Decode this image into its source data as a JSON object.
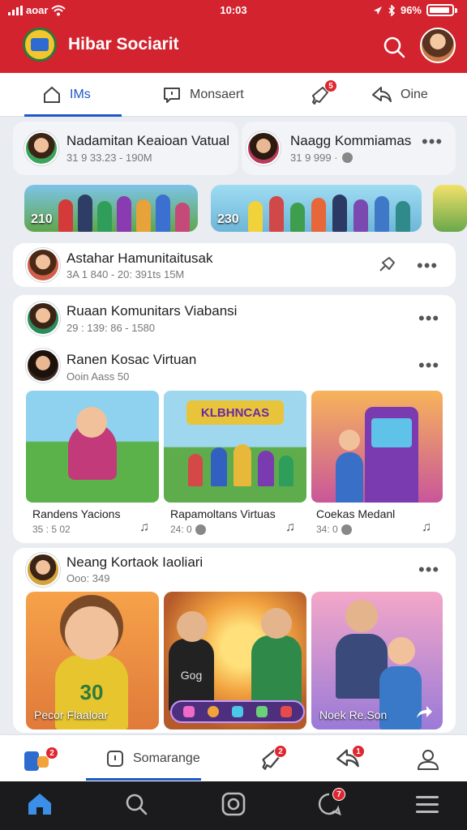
{
  "status": {
    "carrier": "aoar",
    "time": "10:03",
    "battery": "96%"
  },
  "app": {
    "title": "Hibar Sociarit"
  },
  "tabs": [
    {
      "label": "IMs"
    },
    {
      "label": "Monsaert"
    },
    {
      "label": "",
      "badge": "5"
    },
    {
      "label": "Oine"
    }
  ],
  "stories": [
    {
      "name": "Nadamitan Keaioan Vatual",
      "meta": "31 9 33.23 - 190M"
    },
    {
      "name": "Naagg Kommiamas",
      "meta": "31 9 999 ·"
    }
  ],
  "banners": [
    {
      "count": "210"
    },
    {
      "count": "230"
    }
  ],
  "post1": {
    "name": "Astahar Hamunitaitusak",
    "meta": "3A 1 840 - 20: 391ts 15M"
  },
  "group": {
    "name": "Ruaan Komunitars Viabansi",
    "meta": "29 : 139: 86 - 1580",
    "sub": {
      "name": "Ranen Kosac Virtuan",
      "meta": "Ooin Aass 50"
    },
    "tiles": [
      {
        "title": "Randens Yacions",
        "meta": "35 : 5 02"
      },
      {
        "title": "Rapamoltans Virtuas",
        "meta": "24: 0",
        "banner_text": "KLBHNCAS"
      },
      {
        "title": "Coekas Medanl",
        "meta": "34: 0"
      }
    ]
  },
  "post2": {
    "name": "Neang Kortaok Iaoliari",
    "meta": "Ooo: 349",
    "tiles": [
      {
        "caption": "Pecor Flaaloar",
        "shirt": "30"
      },
      {
        "caption": "",
        "shirt": "Gog"
      },
      {
        "caption": "Noek Re.Son"
      }
    ]
  },
  "bottom_nav": {
    "badge1": "2",
    "label": "Somarange",
    "badge2": "2",
    "badge3": "1"
  },
  "system_nav": {
    "badge": "7"
  },
  "colors": {
    "brand": "#d3232f",
    "accent": "#1f58c5",
    "badge": "#e0262f"
  }
}
